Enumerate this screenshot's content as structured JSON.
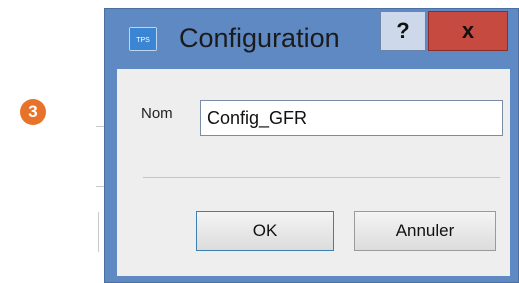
{
  "step_badge": "3",
  "dialog": {
    "title": "Configuration",
    "help_label": "?",
    "close_label": "x",
    "name_label": "Nom",
    "name_value": "Config_GFR",
    "ok_label": "OK",
    "cancel_label": "Annuler",
    "app_icon_text": "TPS"
  },
  "colors": {
    "badge": "#e8722a",
    "title_bar": "#5f89c2",
    "close_button": "#c74a41"
  }
}
